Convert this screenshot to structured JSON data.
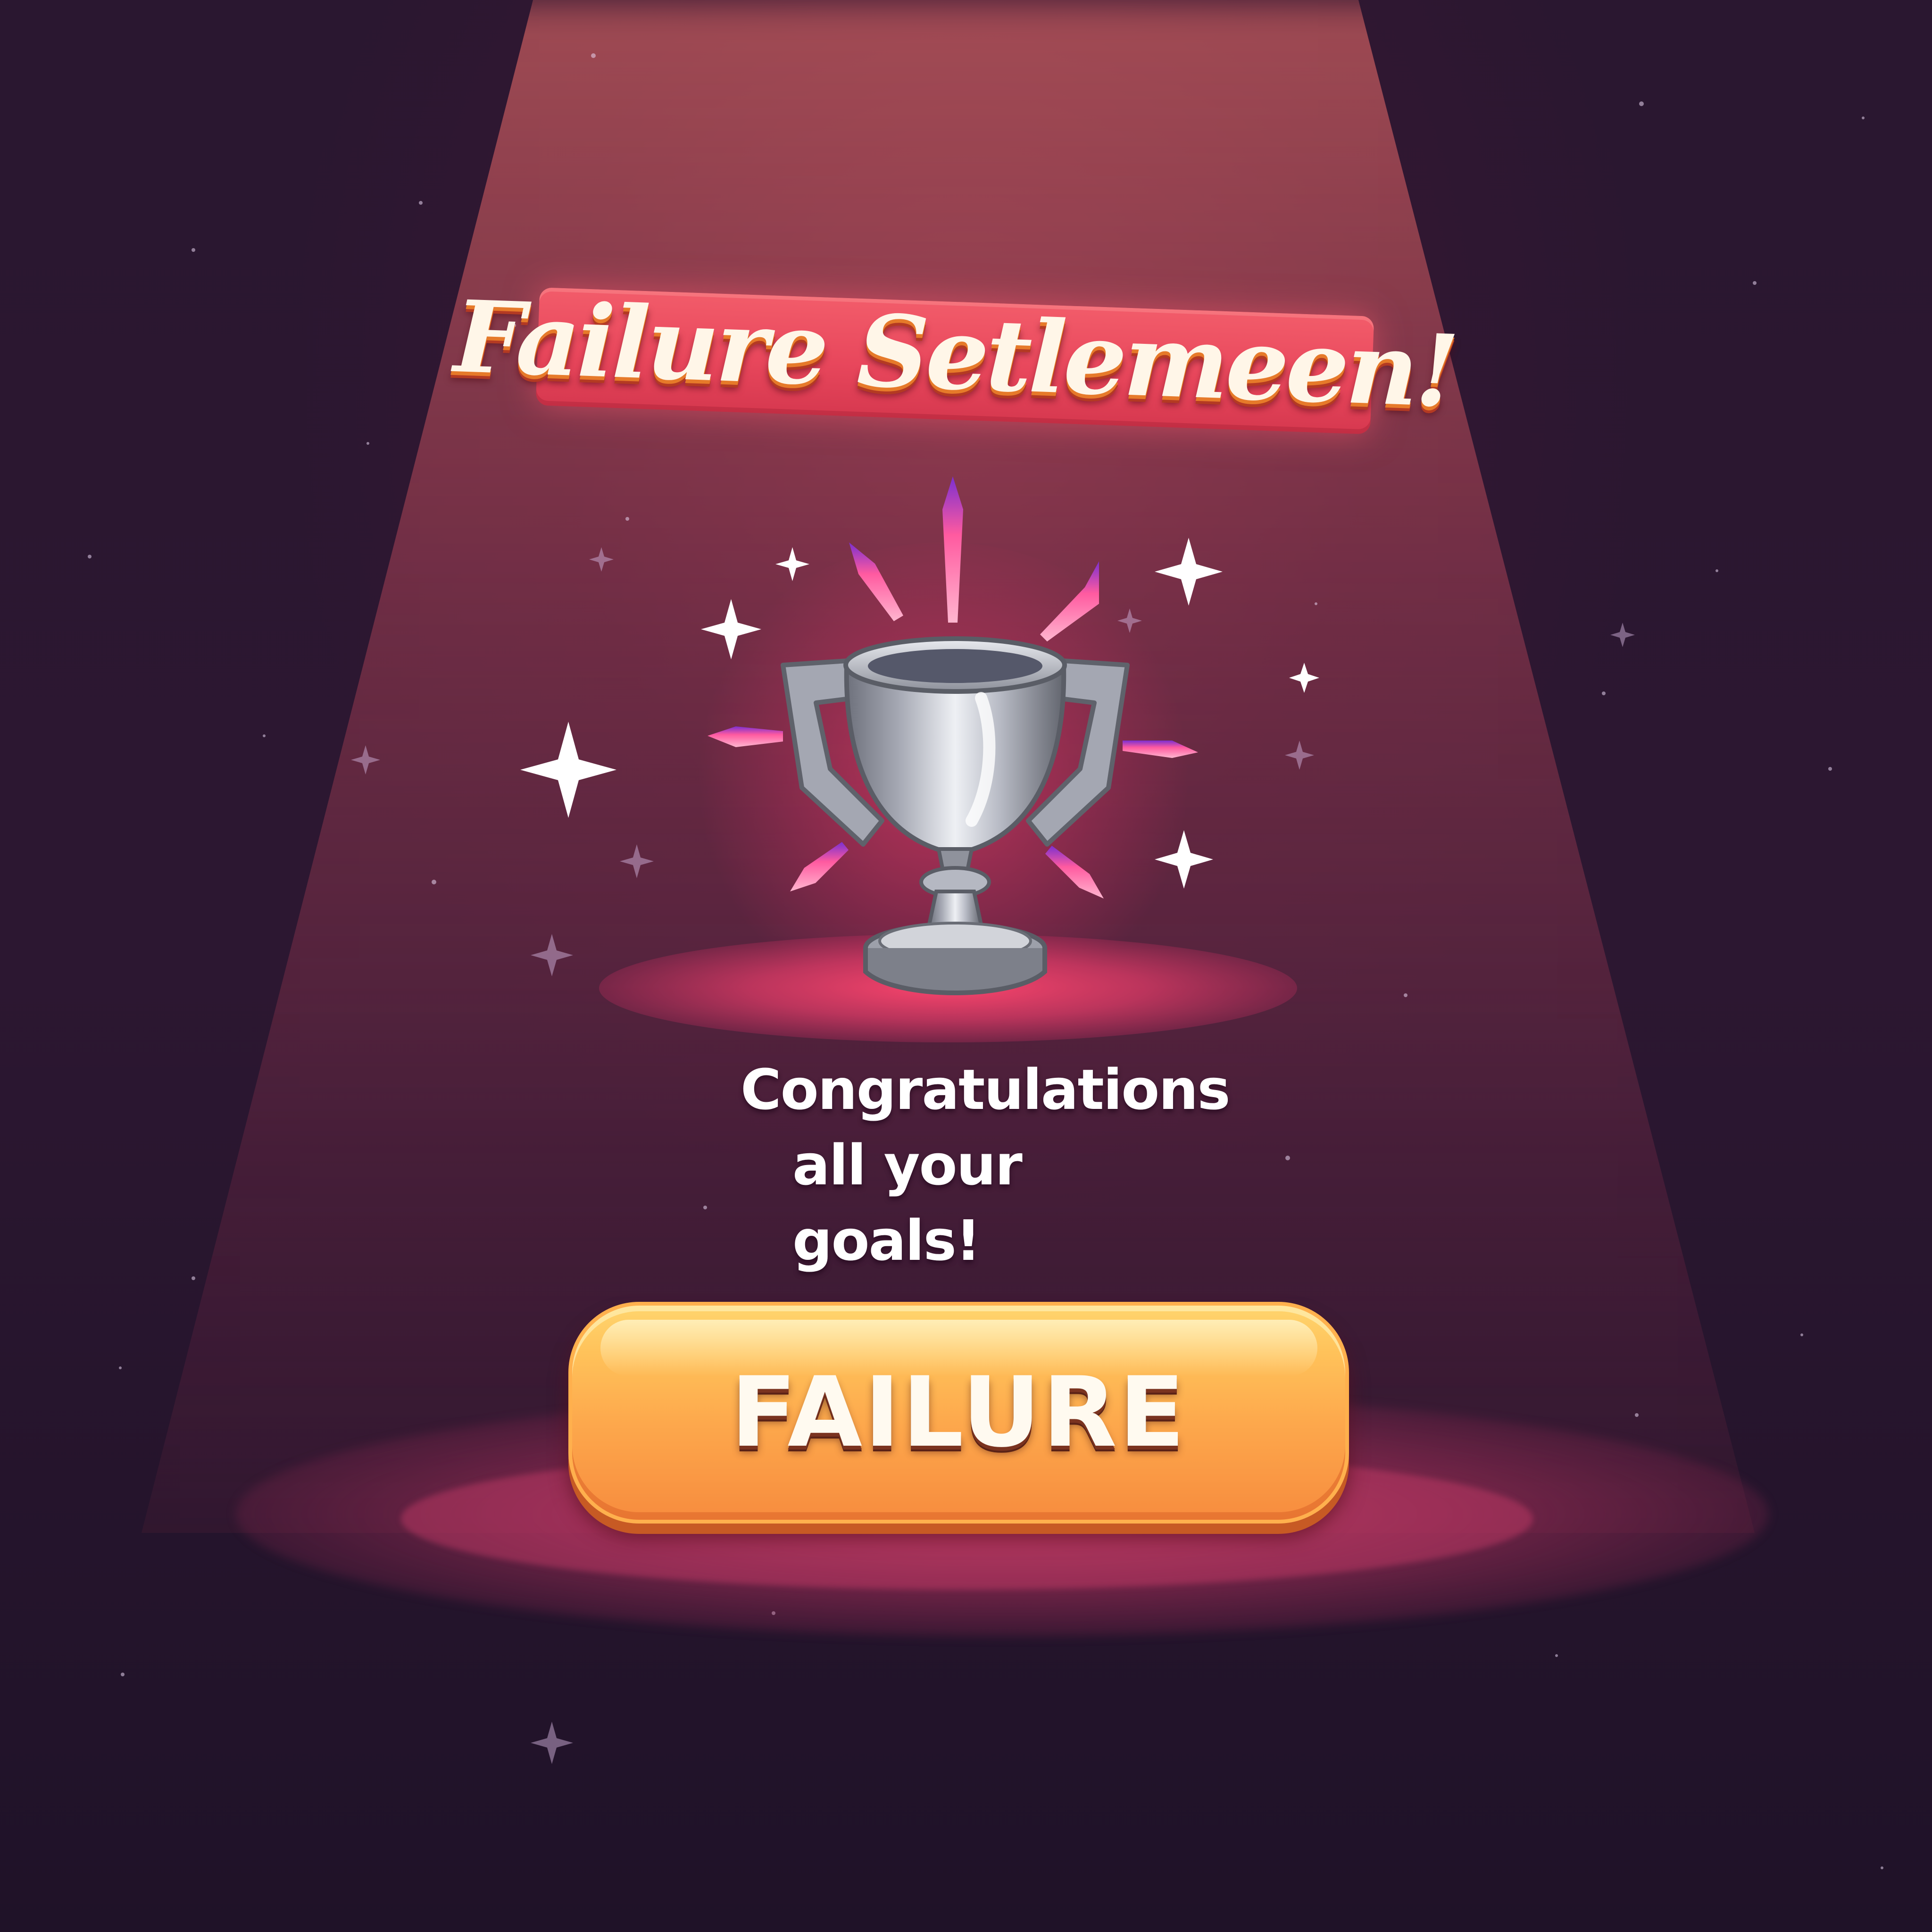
{
  "banner": {
    "title": "Failure Setlemeen!"
  },
  "trophy": {
    "icon": "silver-trophy-icon"
  },
  "message": {
    "line1": "Congratulations",
    "line2": "all your goals!"
  },
  "action_button": {
    "label": "FAILURE"
  },
  "colors": {
    "banner_red": "#e8475c",
    "button_orange": "#fda84c",
    "button_yellow": "#ffd56e",
    "glow_pink": "#ff4670",
    "background_dark": "#241528",
    "trophy_silver": "#b9bcc6"
  }
}
